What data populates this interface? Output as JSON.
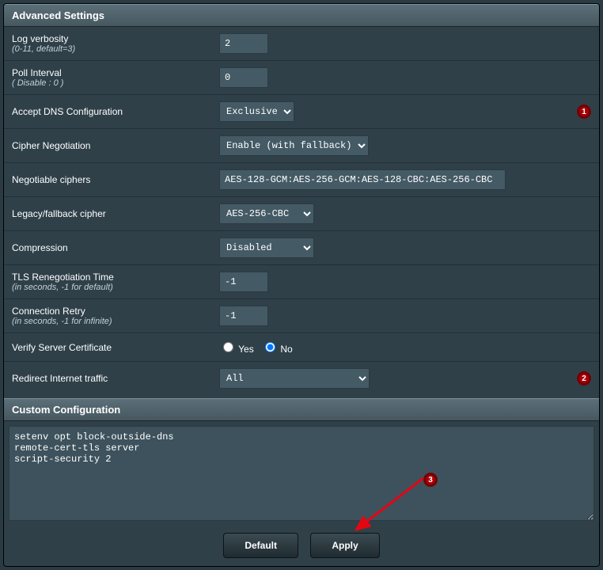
{
  "sections": {
    "advanced_title": "Advanced Settings",
    "custom_title": "Custom Configuration"
  },
  "fields": {
    "log_verbosity": {
      "label": "Log verbosity",
      "hint": "(0-11, default=3)",
      "value": "2"
    },
    "poll_interval": {
      "label": "Poll Interval",
      "hint": "( Disable : 0 )",
      "value": "0"
    },
    "accept_dns": {
      "label": "Accept DNS Configuration",
      "value": "Exclusive",
      "badge": "1"
    },
    "cipher_neg": {
      "label": "Cipher Negotiation",
      "value": "Enable (with fallback)"
    },
    "neg_ciphers": {
      "label": "Negotiable ciphers",
      "value": "AES-128-GCM:AES-256-GCM:AES-128-CBC:AES-256-CBC"
    },
    "legacy_cipher": {
      "label": "Legacy/fallback cipher",
      "value": "AES-256-CBC"
    },
    "compression": {
      "label": "Compression",
      "value": "Disabled"
    },
    "tls_reneg": {
      "label": "TLS Renegotiation Time",
      "hint": "(in seconds, -1 for default)",
      "value": "-1"
    },
    "conn_retry": {
      "label": "Connection Retry",
      "hint": "(in seconds, -1 for infinite)",
      "value": "-1"
    },
    "verify_cert": {
      "label": "Verify Server Certificate",
      "yes": "Yes",
      "no": "No",
      "selected": "no"
    },
    "redirect": {
      "label": "Redirect Internet traffic",
      "value": "All",
      "badge": "2"
    }
  },
  "custom_config": "setenv opt block-outside-dns\nremote-cert-tls server\nscript-security 2",
  "annotations": {
    "arrow_badge": "3"
  },
  "buttons": {
    "default": "Default",
    "apply": "Apply"
  }
}
